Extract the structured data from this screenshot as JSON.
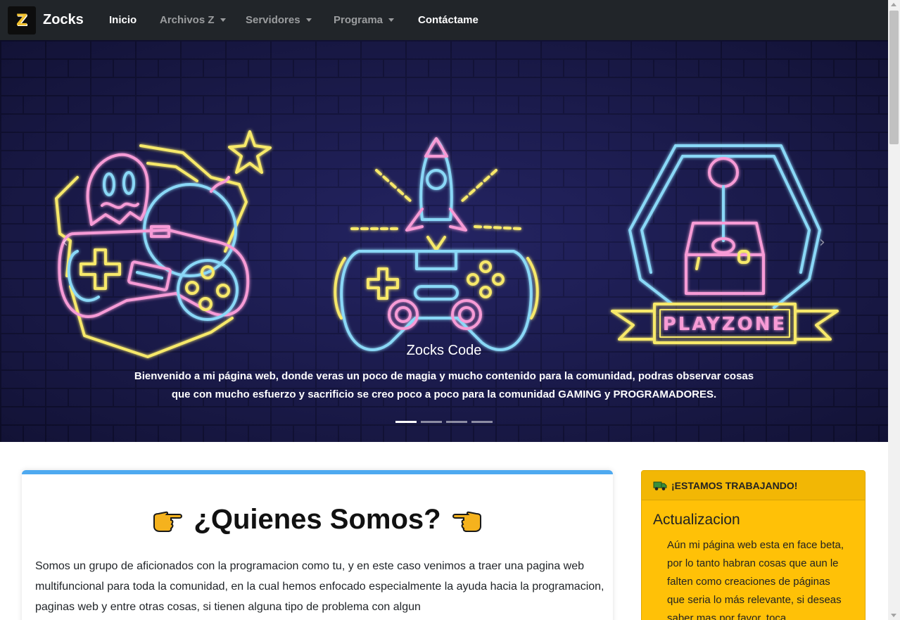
{
  "navbar": {
    "logo_letter": "Z",
    "brand": "Zocks",
    "items": [
      {
        "label": "Inicio",
        "active": true,
        "dropdown": false
      },
      {
        "label": "Archivos Z",
        "active": false,
        "dropdown": true
      },
      {
        "label": "Servidores",
        "active": false,
        "dropdown": true
      },
      {
        "label": "Programa",
        "active": false,
        "dropdown": true
      },
      {
        "label": "Contáctame",
        "active": true,
        "dropdown": false
      }
    ]
  },
  "carousel": {
    "prev_icon": "‹",
    "next_icon": "›",
    "caption_title": "Zocks Code",
    "caption_text_1": "Bienvenido a mi página web, donde veras un poco de magia y mucho contenido para la comunidad, podras observar cosas que con mucho esfuerzo y sacrificio se creo poco a poco para la comunidad ",
    "caption_strong": "GAMING y PROGRAMADORES",
    "caption_text_2": ".",
    "neon_sign_text": "PLAYZONE",
    "slide_count": 4,
    "active_slide": 1
  },
  "about": {
    "title": "¿Quienes Somos?",
    "text": "Somos un grupo de aficionados con la programacion como tu, y en este caso venimos a traer una pagina web multifuncional para toda la comunidad, en la cual hemos enfocado especialmente la ayuda hacia la programacion, paginas web y entre otras cosas, si tienen alguna tipo de problema con algun"
  },
  "notice": {
    "header_icon": "truck-icon",
    "header": "¡ESTAMOS TRABAJANDO!",
    "title": "Actualizacion",
    "text": "Aún mi página web esta en face beta, por lo tanto habran cosas que aun le falten como creaciones de páginas que seria lo más relevante, si deseas saber mas por favor, toca"
  },
  "colors": {
    "navbar_bg": "#212529",
    "card_accent": "#4ea9f0",
    "notice_bg": "#ffc107"
  }
}
